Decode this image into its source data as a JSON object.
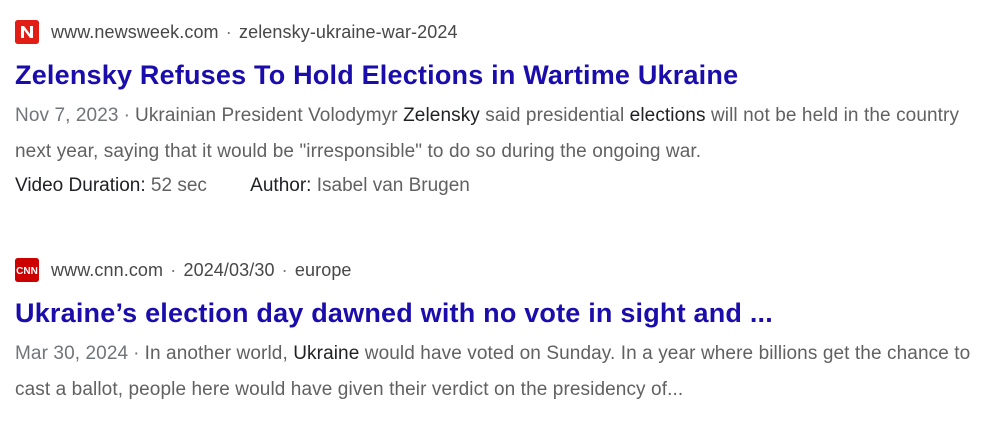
{
  "results": [
    {
      "favicon": {
        "letter": "N",
        "color": "#e11d16",
        "icon": "newsweek-icon"
      },
      "domain": "www.newsweek.com",
      "separator": "·",
      "path": "zelensky-ukraine-war-2024",
      "title": "Zelensky Refuses To Hold Elections in Wartime Ukraine",
      "date": "Nov 7, 2023",
      "snippet_parts": [
        "Ukrainian President Volodymyr ",
        "Zelensky",
        " said presidential ",
        "elections",
        " will not be held in the country next year, saying that it would be \"irresponsible\" to do so during the ongoing war."
      ],
      "meta": {
        "duration_key": "Video Duration:",
        "duration_val": "52 sec",
        "author_key": "Author:",
        "author_val": "Isabel van Brugen"
      }
    },
    {
      "favicon": {
        "letter": "CNN",
        "color": "#cc0000",
        "icon": "cnn-icon"
      },
      "domain": "www.cnn.com",
      "separator": "·",
      "path": "2024/03/30",
      "path2": "europe",
      "title": "Ukraine’s election day dawned with no vote in sight and ...",
      "date": "Mar 30, 2024",
      "snippet_parts": [
        "In another world, ",
        "Ukraine",
        " would have voted on Sunday. In a year where billions get the chance to cast a ballot, people here would have given their verdict on the presidency of..."
      ]
    }
  ]
}
